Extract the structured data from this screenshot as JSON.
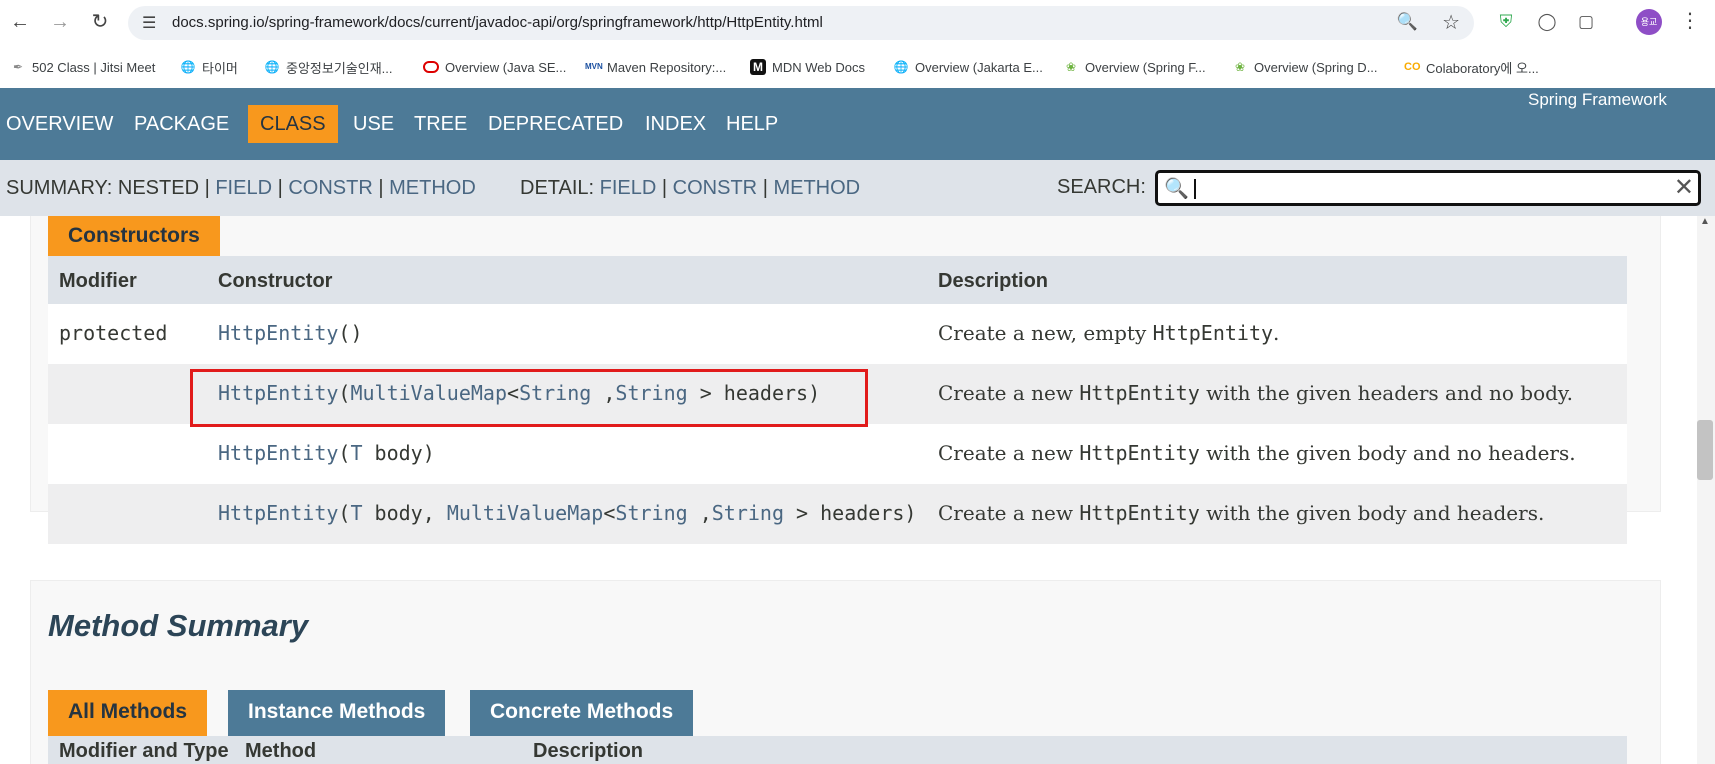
{
  "browser": {
    "url": "docs.spring.io/spring-framework/docs/current/javadoc-api/org/springframework/http/HttpEntity.html",
    "profile_initials": "용교",
    "bookmarks": [
      {
        "label": "502 Class | Jitsi Meet",
        "icon": "jitsi-icon"
      },
      {
        "label": "타이머",
        "icon": "globe-icon"
      },
      {
        "label": "중앙정보기술인재...",
        "icon": "globe-icon"
      },
      {
        "label": "Overview (Java SE...",
        "icon": "oracle-icon"
      },
      {
        "label": "Maven Repository:...",
        "icon": "maven-icon"
      },
      {
        "label": "MDN Web Docs",
        "icon": "mdn-icon"
      },
      {
        "label": "Overview (Jakarta E...",
        "icon": "globe-icon"
      },
      {
        "label": "Overview (Spring F...",
        "icon": "spring-icon"
      },
      {
        "label": "Overview (Spring D...",
        "icon": "spring-icon"
      },
      {
        "label": "Colaboratory에 오...",
        "icon": "colab-icon"
      }
    ]
  },
  "topnav": {
    "items": [
      "OVERVIEW",
      "PACKAGE",
      "CLASS",
      "USE",
      "TREE",
      "DEPRECATED",
      "INDEX",
      "HELP"
    ],
    "active": "CLASS",
    "brand": "Spring Framework"
  },
  "subnav": {
    "summary_label": "SUMMARY:",
    "summary_nested": "NESTED",
    "summary_field": "FIELD",
    "summary_constr": "CONSTR",
    "summary_method": "METHOD",
    "detail_label": "DETAIL:",
    "detail_field": "FIELD",
    "detail_constr": "CONSTR",
    "detail_method": "METHOD",
    "sep": "|",
    "search_label": "SEARCH:"
  },
  "constructors": {
    "caption": "Constructors",
    "headers": {
      "modifier": "Modifier",
      "constructor": "Constructor",
      "description": "Description"
    },
    "rows": [
      {
        "modifier": "protected",
        "name": "HttpEntity",
        "open": "(",
        "params": "",
        "close": ")",
        "desc_pre": "Create a new, empty ",
        "desc_code": "HttpEntity",
        "desc_post": "."
      },
      {
        "modifier": "",
        "name": "HttpEntity",
        "open": "(",
        "t1": "MultiValueMap",
        "lt": "<",
        "t2": "String",
        "comma": " ,",
        "t3": "String",
        "gt": " > ",
        "params": "headers",
        "close": ")",
        "desc_pre": "Create a new ",
        "desc_code": "HttpEntity",
        "desc_post": " with the given headers and no body."
      },
      {
        "modifier": "",
        "name": "HttpEntity",
        "open": "(",
        "t1": "T",
        "params": " body",
        "close": ")",
        "desc_pre": "Create a new ",
        "desc_code": "HttpEntity",
        "desc_post": " with the given body and no headers."
      },
      {
        "modifier": "",
        "name": "HttpEntity",
        "open": "(",
        "t1": "T",
        "p1": " body, ",
        "t2": "MultiValueMap",
        "lt": "<",
        "t3": "String",
        "comma": " ,",
        "t4": "String",
        "gt": " > ",
        "params": "headers",
        "close": ")",
        "desc_pre": "Create a new ",
        "desc_code": "HttpEntity",
        "desc_post": " with the given body and headers."
      }
    ]
  },
  "methods": {
    "title": "Method Summary",
    "tabs": [
      "All Methods",
      "Instance Methods",
      "Concrete Methods"
    ],
    "headers": {
      "type": "Modifier and Type",
      "method": "Method",
      "description": "Description"
    }
  },
  "colors": {
    "nav": "#4d7a97",
    "active_tab": "#f8981d",
    "subnav": "#dee3e9",
    "link": "#4a6782",
    "highlight": "#e11b1b"
  }
}
